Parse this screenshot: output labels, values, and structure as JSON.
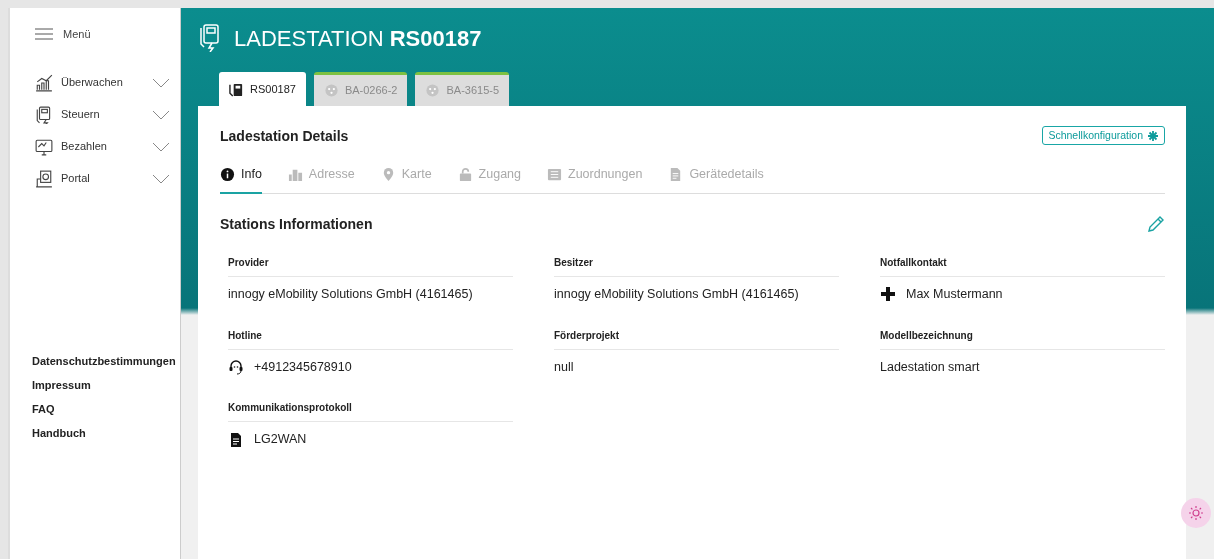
{
  "sidebar": {
    "menu_label": "Menü",
    "items": [
      {
        "label": "Überwachen",
        "expanded": false
      },
      {
        "label": "Steuern",
        "expanded": false
      },
      {
        "label": "Bezahlen",
        "expanded": false
      },
      {
        "label": "Portal",
        "expanded": false
      }
    ],
    "footer_links": [
      "Datenschutzbestimmungen",
      "Impressum",
      "FAQ",
      "Handbuch"
    ]
  },
  "header": {
    "title": "LADESTATION **RS00187**"
  },
  "station_tabs": [
    {
      "label": "RS00187",
      "selected": true
    },
    {
      "label": "BA-0266-2",
      "selected": false
    },
    {
      "label": "BA-3615-5",
      "selected": false
    }
  ],
  "card": {
    "title": "Ladestation Details",
    "quick_config": "Schnellkonfiguration",
    "section_tabs": [
      {
        "label": "Info",
        "selected": true
      },
      {
        "label": "Adresse",
        "selected": false
      },
      {
        "label": "Karte",
        "selected": false
      },
      {
        "label": "Zugang",
        "selected": false
      },
      {
        "label": "Zuordnungen",
        "selected": false
      },
      {
        "label": "Gerätedetails",
        "selected": false
      }
    ],
    "section_title": "Stations Informationen",
    "fields": [
      {
        "label": "Provider",
        "value": "innogy eMobility Solutions GmbH (4161465)"
      },
      {
        "label": "Besitzer",
        "value": "innogy eMobility Solutions GmbH (4161465)"
      },
      {
        "label": "Notfallkontakt",
        "value": "Max Mustermann"
      },
      {
        "label": "Hotline",
        "value": "+4912345678910"
      },
      {
        "label": "Förderprojekt",
        "value": "null"
      },
      {
        "label": "Modellbezeichnung",
        "value": "Ladestation smart"
      },
      {
        "label": "Kommunikationsprotokoll",
        "value": "LG2WAN"
      }
    ]
  }
}
